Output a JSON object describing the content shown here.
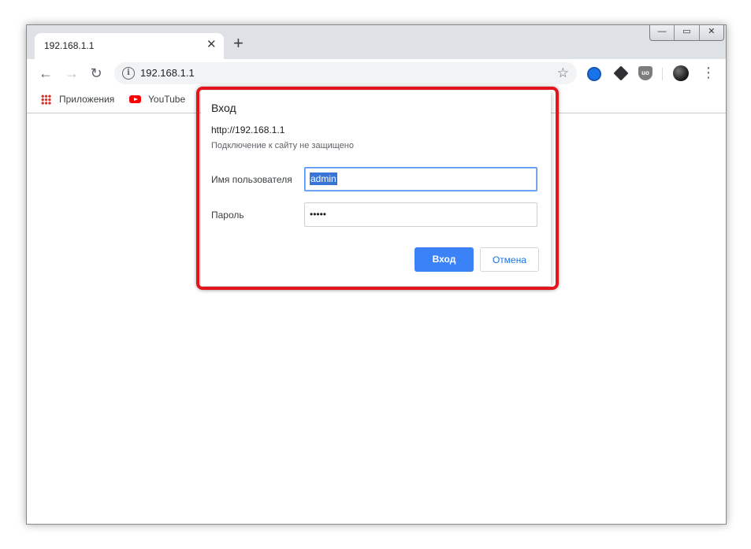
{
  "browser": {
    "tab": {
      "title": "192.168.1.1",
      "close": "✕"
    },
    "new_tab": "+",
    "window_controls": {
      "minimize": "—",
      "maximize": "▭",
      "close": "✕"
    },
    "nav": {
      "back": "←",
      "forward": "→",
      "reload": "↻"
    },
    "address_bar": {
      "info": "i",
      "url": "192.168.1.1",
      "star": "☆"
    },
    "menu": "⋮",
    "extensions": [
      "globe-icon",
      "cube-icon",
      "ublock-shield-icon"
    ],
    "ublock_text": "uo",
    "bookmarks": [
      {
        "label": "Приложения",
        "icon": "apps-grid-icon"
      },
      {
        "label": "YouTube",
        "icon": "youtube-icon"
      }
    ]
  },
  "dialog": {
    "title": "Вход",
    "url": "http://192.168.1.1",
    "warning": "Подключение к сайту не защищено",
    "username_label": "Имя пользователя",
    "username_value": "admin",
    "password_label": "Пароль",
    "password_value": "•••••",
    "ok_label": "Вход",
    "cancel_label": "Отмена"
  },
  "colors": {
    "highlight": "#e3141b",
    "primary_button": "#3b82f6",
    "tabstrip": "#dee1e6"
  }
}
